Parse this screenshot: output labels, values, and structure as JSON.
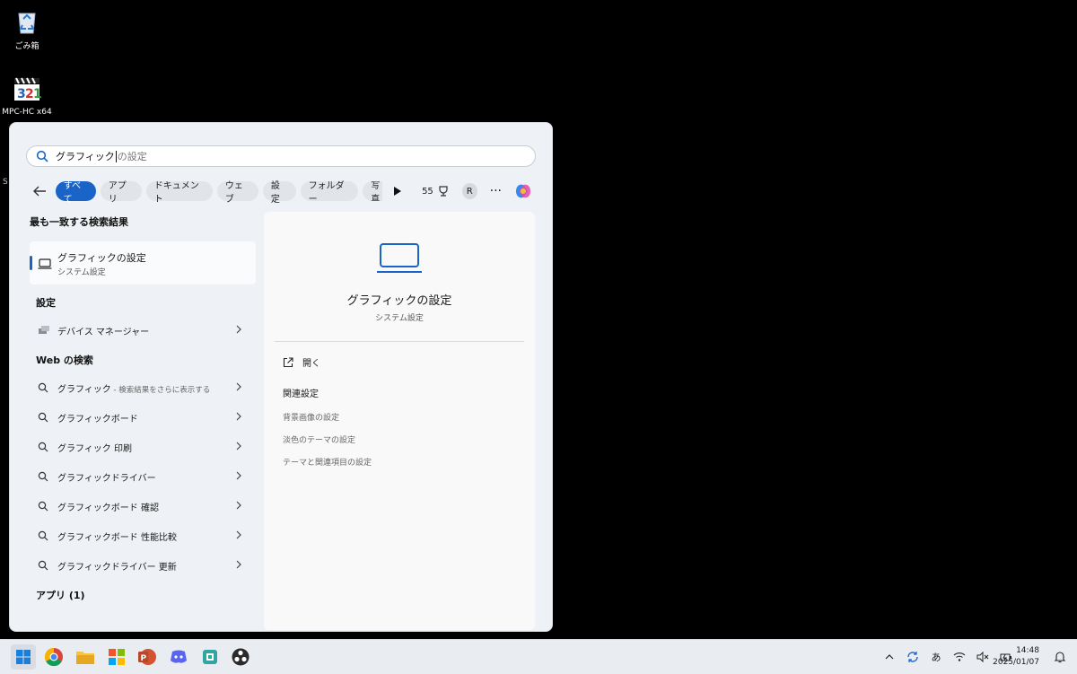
{
  "desktop": {
    "icons": [
      {
        "label": "ごみ箱",
        "icon": "recycle-bin-icon"
      },
      {
        "label": "MPC-HC x64",
        "icon": "mpc-hc-icon"
      }
    ],
    "edge_text": "S"
  },
  "search": {
    "typed": "グラフィック",
    "suggestion": "の設定"
  },
  "filters": {
    "chips": [
      "すべて",
      "アプリ",
      "ドキュメント",
      "ウェブ",
      "設定",
      "フォルダー",
      "写真"
    ],
    "active": "すべて",
    "points": "55",
    "avatar": "R",
    "more": "···"
  },
  "best_match": {
    "heading": "最も一致する検索結果",
    "title": "グラフィックの設定",
    "subtitle": "システム設定"
  },
  "settings_section": {
    "heading": "設定",
    "items": [
      {
        "label": "デバイス マネージャー",
        "icon": "device-manager-icon"
      }
    ]
  },
  "web_section": {
    "heading": "Web の検索",
    "items": [
      {
        "label": "グラフィック",
        "hint": " - 検索結果をさらに表示する"
      },
      {
        "label": "グラフィックボード",
        "hint": ""
      },
      {
        "label": "グラフィック 印刷",
        "hint": ""
      },
      {
        "label": "グラフィックドライバー",
        "hint": ""
      },
      {
        "label": "グラフィックボード 確認",
        "hint": ""
      },
      {
        "label": "グラフィックボード 性能比較",
        "hint": ""
      },
      {
        "label": "グラフィックドライバー 更新",
        "hint": ""
      }
    ]
  },
  "apps_section": {
    "heading": "アプリ (1)"
  },
  "detail": {
    "title": "グラフィックの設定",
    "subtitle": "システム設定",
    "open_label": "開く",
    "related_heading": "関連設定",
    "related_links": [
      "背景画像の設定",
      "淡色のテーマの設定",
      "テーマと関連項目の設定"
    ]
  },
  "taskbar": {
    "apps": [
      "windows-start-icon",
      "chrome-icon",
      "file-explorer-icon",
      "microsoft-store-icon",
      "powerpoint-icon",
      "discord-icon",
      "app-icon",
      "obs-icon"
    ],
    "ime": "あ",
    "time": "14:48",
    "date": "2025/01/07"
  },
  "colors": {
    "accent": "#1a64c8",
    "panel": "#eef1f5",
    "desktop": "#000000"
  }
}
